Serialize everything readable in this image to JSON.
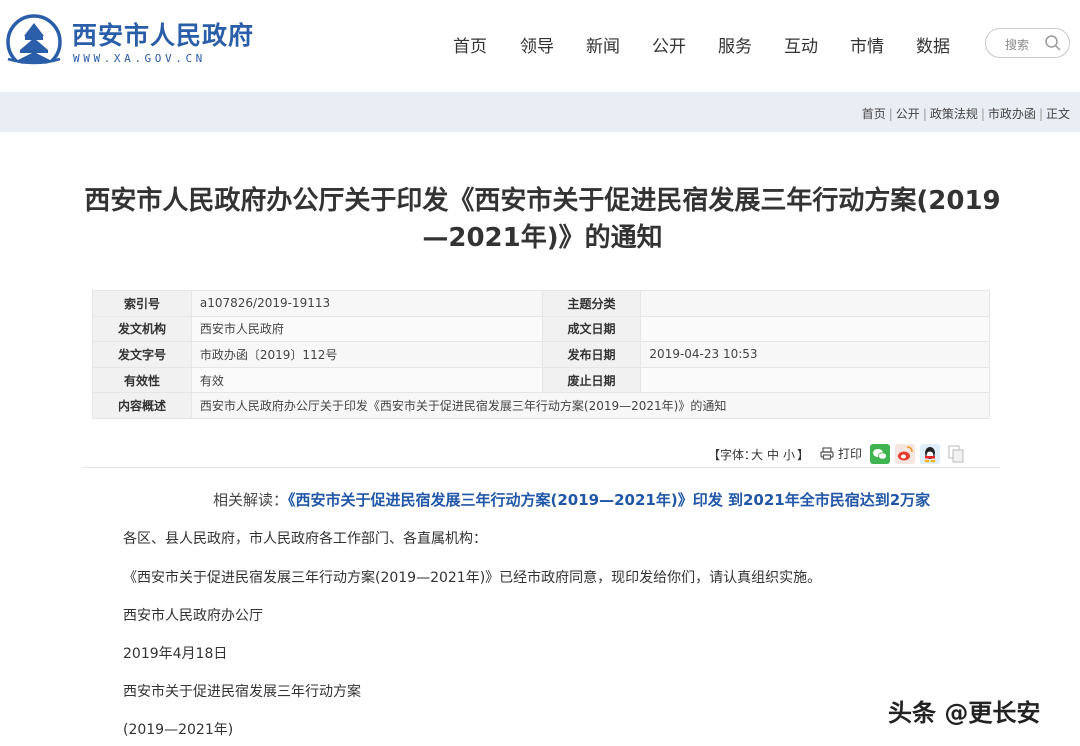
{
  "site": {
    "name": "西安市人民政府",
    "url": "WWW.XA.GOV.CN"
  },
  "nav": {
    "items": [
      "首页",
      "领导",
      "新闻",
      "公开",
      "服务",
      "互动",
      "市情",
      "数据"
    ]
  },
  "search": {
    "placeholder": "搜索"
  },
  "breadcrumb": {
    "items": [
      "首页",
      "公开",
      "政策法规",
      "市政办函",
      "正文"
    ],
    "sep": "|"
  },
  "article": {
    "title_line1": "西安市人民政府办公厅关于印发《西安市关于促进民宿发展三年行动方案(2019",
    "title_line2": "—2021年)》的通知"
  },
  "meta": {
    "index_label": "索引号",
    "index_value": "a107826/2019-19113",
    "topic_label": "主题分类",
    "topic_value": "",
    "org_label": "发文机构",
    "org_value": "西安市人民政府",
    "created_label": "成文日期",
    "created_value": "",
    "docno_label": "发文字号",
    "docno_value": "市政办函〔2019〕112号",
    "pub_label": "发布日期",
    "pub_value": "2019-04-23 10:53",
    "valid_label": "有效性",
    "valid_value": "有效",
    "expire_label": "废止日期",
    "expire_value": "",
    "summary_label": "内容概述",
    "summary_value": "西安市人民政府办公厅关于印发《西安市关于促进民宿发展三年行动方案(2019—2021年)》的通知"
  },
  "tools": {
    "font_prefix": "【字体：",
    "font_large": "大",
    "font_medium": "中",
    "font_small": "小",
    "font_suffix": "】",
    "print": "打印"
  },
  "body": {
    "related_label": "相关解读：",
    "related_link": "《西安市关于促进民宿发展三年行动方案(2019—2021年)》印发 到2021年全市民宿达到2万家",
    "p1": "各区、县人民政府，市人民政府各工作部门、各直属机构：",
    "p2": "《西安市关于促进民宿发展三年行动方案(2019—2021年)》已经市政府同意，现印发给你们，请认真组织实施。",
    "p3": "西安市人民政府办公厅",
    "p4": "2019年4月18日",
    "p5": "西安市关于促进民宿发展三年行动方案",
    "p6": "(2019—2021年)"
  },
  "watermark": "头条 @更长安",
  "colors": {
    "brand": "#2a5ea8",
    "link": "#2157a8",
    "crumb_bg": "#e9edf4"
  }
}
